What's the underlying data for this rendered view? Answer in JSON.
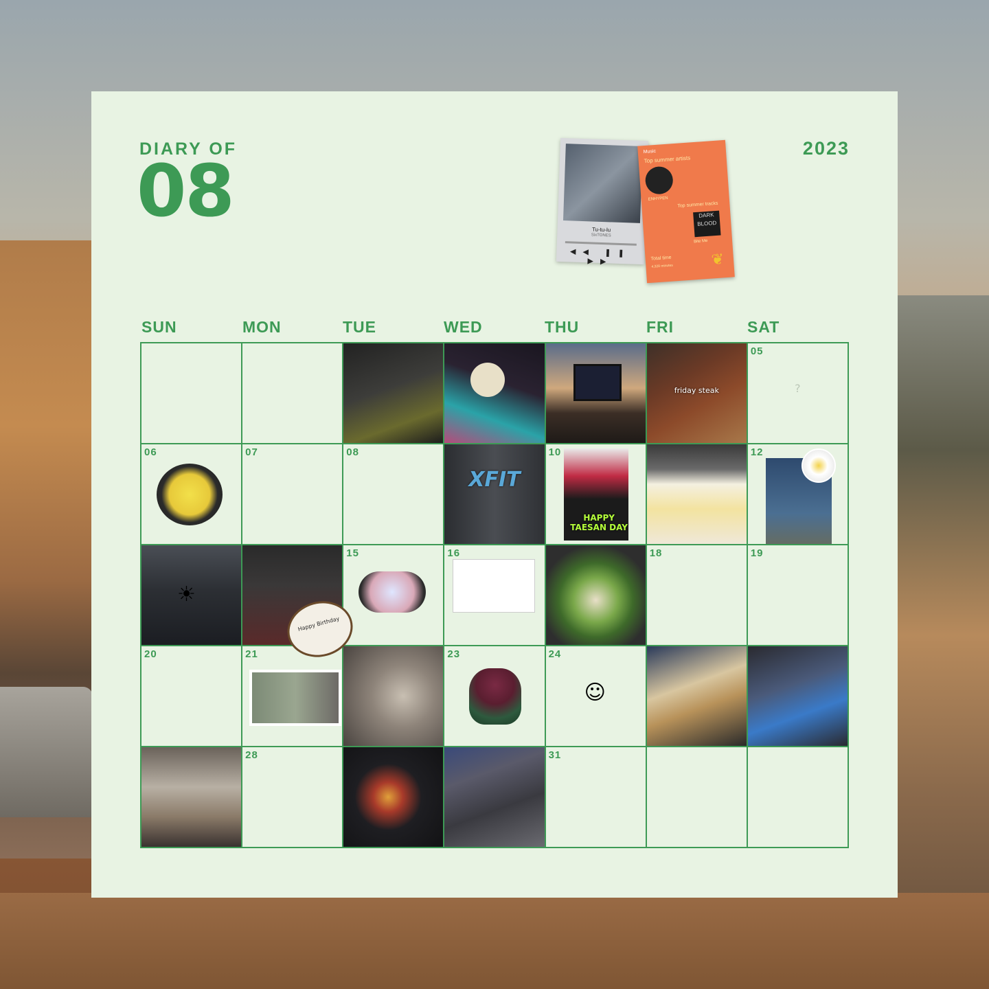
{
  "header": {
    "diary_of": "DIARY OF",
    "month": "08",
    "year": "2023"
  },
  "music": {
    "song_title": "Tu-tu-lu",
    "song_artist": "SixTONES",
    "controls": "◀◀ ❚❚ ▶▶",
    "stats_brand": "Music",
    "top_artists_label": "Top summer artists",
    "top_artist_name": "ENHYPEN",
    "top_tracks_label": "Top summer tracks",
    "album_title": "DARK BLOOD",
    "track_name": "Bite Me",
    "total_time_label": "Total time",
    "total_time_value": "4,328 minutes"
  },
  "weekdays": [
    "SUN",
    "MON",
    "TUE",
    "WED",
    "THU",
    "FRI",
    "SAT"
  ],
  "calendar": {
    "d05": "05",
    "d06": "06",
    "d07": "07",
    "d08": "08",
    "d10": "10",
    "d12": "12",
    "d15": "15",
    "d16": "16",
    "d18": "18",
    "d19": "19",
    "d20": "20",
    "d21": "21",
    "d23": "23",
    "d24": "24",
    "d28": "28",
    "d31": "31",
    "friday_steak": "friday steak",
    "xfit": "XFIT",
    "taesan_day": "HAPPY TAESAN DAY",
    "question_mark": "?",
    "birthday_cake": "Happy Birthday"
  },
  "colors": {
    "accent": "#3d9a55",
    "sheet": "#e8f3e3",
    "stats_card": "#f07a4b"
  }
}
